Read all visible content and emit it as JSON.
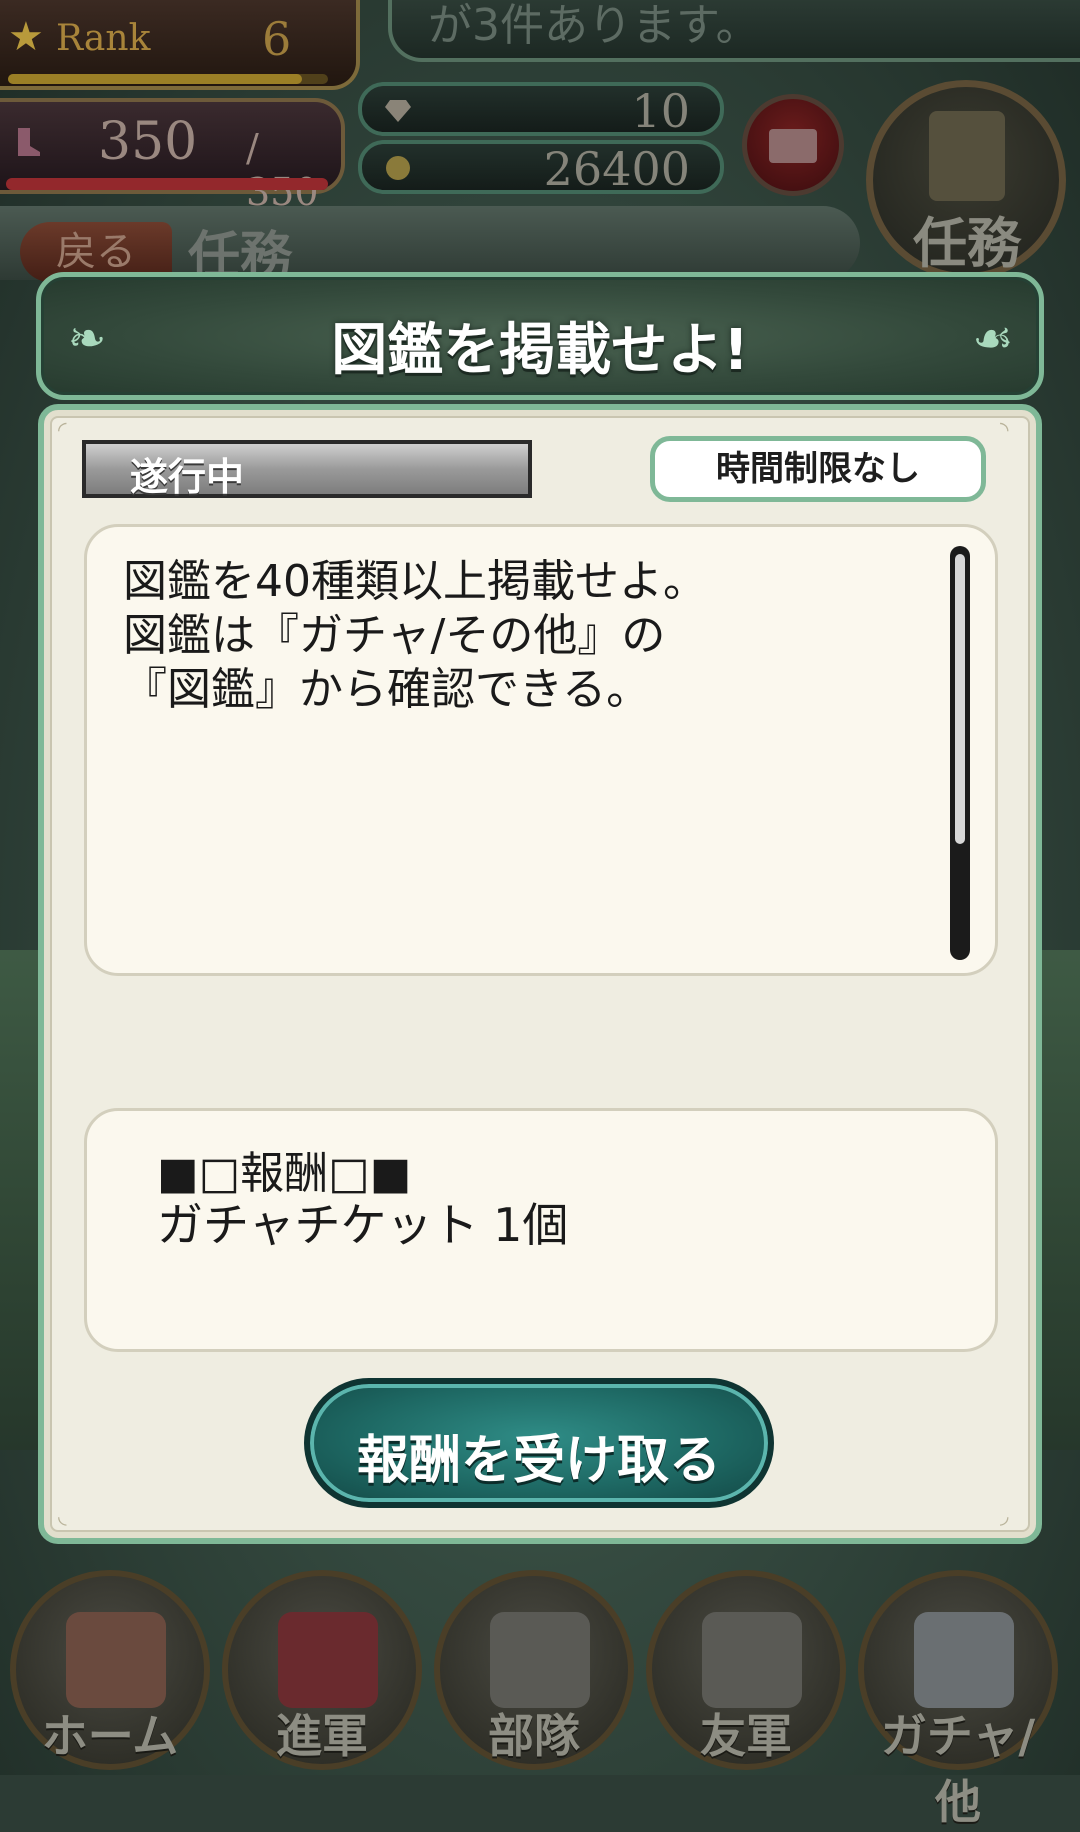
{
  "hud": {
    "rank_label": "Rank",
    "rank_value": "6",
    "rank_progress": 0.92,
    "stamina_current": "350",
    "stamina_max": "/ 350",
    "stamina_progress": 1.0,
    "notice": "が3件あります。",
    "gems": "10",
    "gold": "26400",
    "mission_button_label": "任務"
  },
  "page": {
    "back_label": "戻る",
    "title": "任務"
  },
  "dialog": {
    "title": "図鑑を掲載せよ!",
    "status": "遂行中",
    "time_limit": "時間制限なし",
    "description": "図鑑を40種類以上掲載せよ。\n図鑑は『ガチャ/その他』の\n『図鑑』から確認できる。",
    "reward_header": "■□報酬□■",
    "reward_item": "ガチャチケット 1個",
    "claim_button": "報酬を受け取る"
  },
  "nav": [
    {
      "label": "ホーム",
      "icon": "shield-sword-icon"
    },
    {
      "label": "進軍",
      "icon": "flag-icon"
    },
    {
      "label": "部隊",
      "icon": "helmet-icon"
    },
    {
      "label": "友軍",
      "icon": "handshake-icon"
    },
    {
      "label": "ガチャ/他",
      "icon": "gacha-icon"
    }
  ],
  "colors": {
    "dialog_border": "#7fb897",
    "dialog_header_bg": "#33493b",
    "claim_button_bg": "#1e6964"
  }
}
